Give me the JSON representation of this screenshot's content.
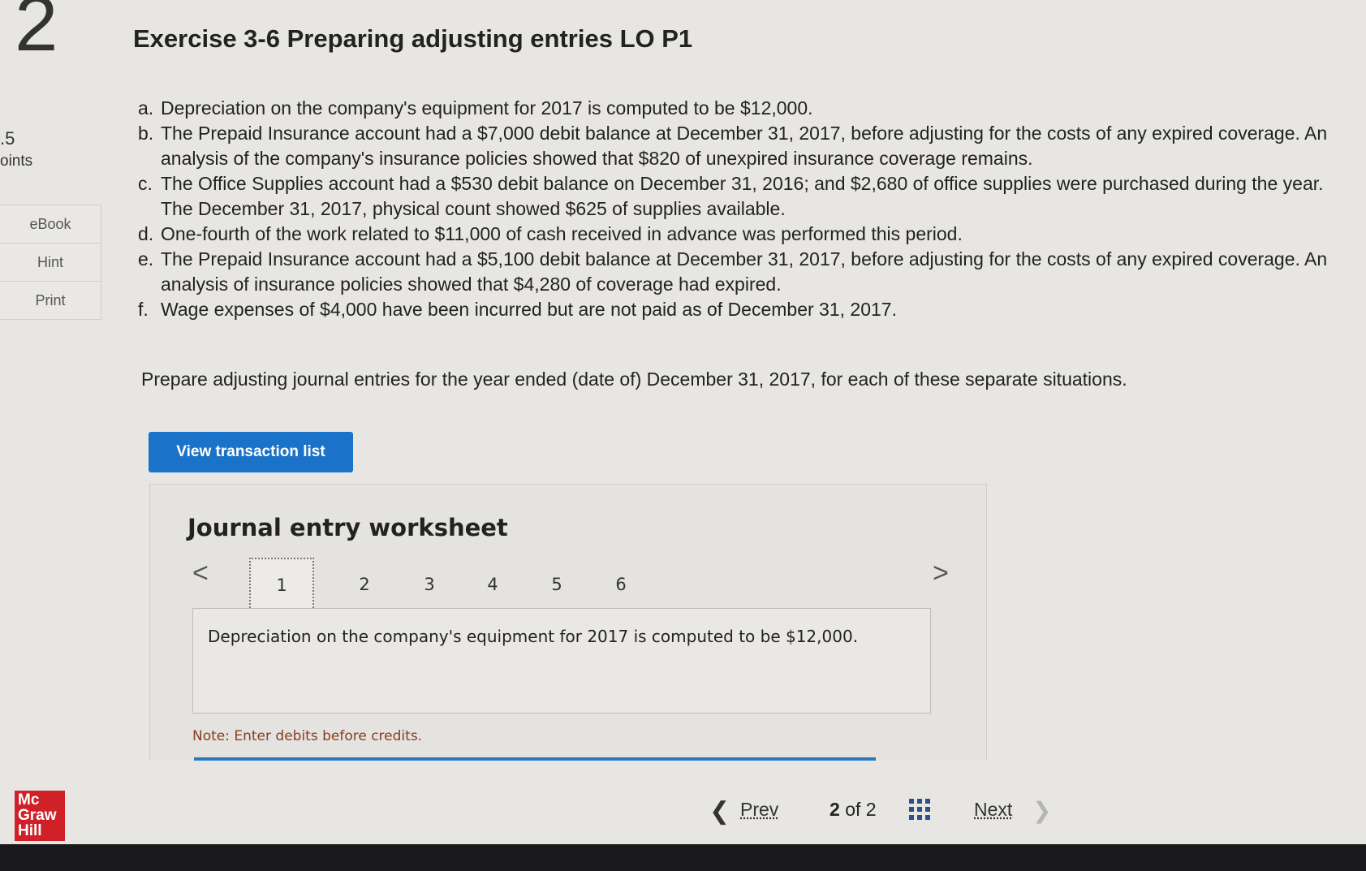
{
  "question": {
    "number": "2",
    "points_value": ".5",
    "points_label": "oints"
  },
  "rail": {
    "ebook": "eBook",
    "hint": "Hint",
    "print": "Print"
  },
  "logo": {
    "line1": "Mc",
    "line2": "Graw",
    "line3": "Hill"
  },
  "exercise": {
    "title": "Exercise 3-6 Preparing adjusting entries LO P1",
    "items": [
      {
        "letter": "a.",
        "text": "Depreciation on the company's equipment for 2017 is computed to be $12,000."
      },
      {
        "letter": "b.",
        "text": "The Prepaid Insurance account had a $7,000 debit balance at December 31, 2017, before adjusting for the costs of any expired coverage. An analysis of the company's insurance policies showed that $820 of unexpired insurance coverage remains."
      },
      {
        "letter": "c.",
        "text": "The Office Supplies account had a $530 debit balance on December 31, 2016; and $2,680 of office supplies were purchased during the year. The December 31, 2017, physical count showed $625 of supplies available."
      },
      {
        "letter": "d.",
        "text": "One-fourth of the work related to $11,000 of cash received in advance was performed this period."
      },
      {
        "letter": "e.",
        "text": "The Prepaid Insurance account had a $5,100 debit balance at December 31, 2017, before adjusting for the costs of any expired coverage. An analysis of insurance policies showed that $4,280 of coverage had expired."
      },
      {
        "letter": "f.",
        "text": "Wage expenses of $4,000 have been incurred but are not paid as of December 31, 2017."
      }
    ],
    "instruction": "Prepare adjusting journal entries for the year ended (date of) December 31, 2017, for each of these separate situations."
  },
  "view_button": "View transaction list",
  "worksheet": {
    "title": "Journal entry worksheet",
    "prev_arrow": "<",
    "next_arrow": ">",
    "tabs": [
      "1",
      "2",
      "3",
      "4",
      "5",
      "6"
    ],
    "active_tab": "1",
    "description": "Depreciation on the company's equipment for 2017 is computed to be $12,000.",
    "note": "Note: Enter debits before credits."
  },
  "footer": {
    "prev": "Prev",
    "current": "2",
    "of": "of",
    "total": "2",
    "next": "Next"
  },
  "colors": {
    "accent": "#1a73c8",
    "logo": "#cf2127",
    "note": "#8a3b1e"
  }
}
